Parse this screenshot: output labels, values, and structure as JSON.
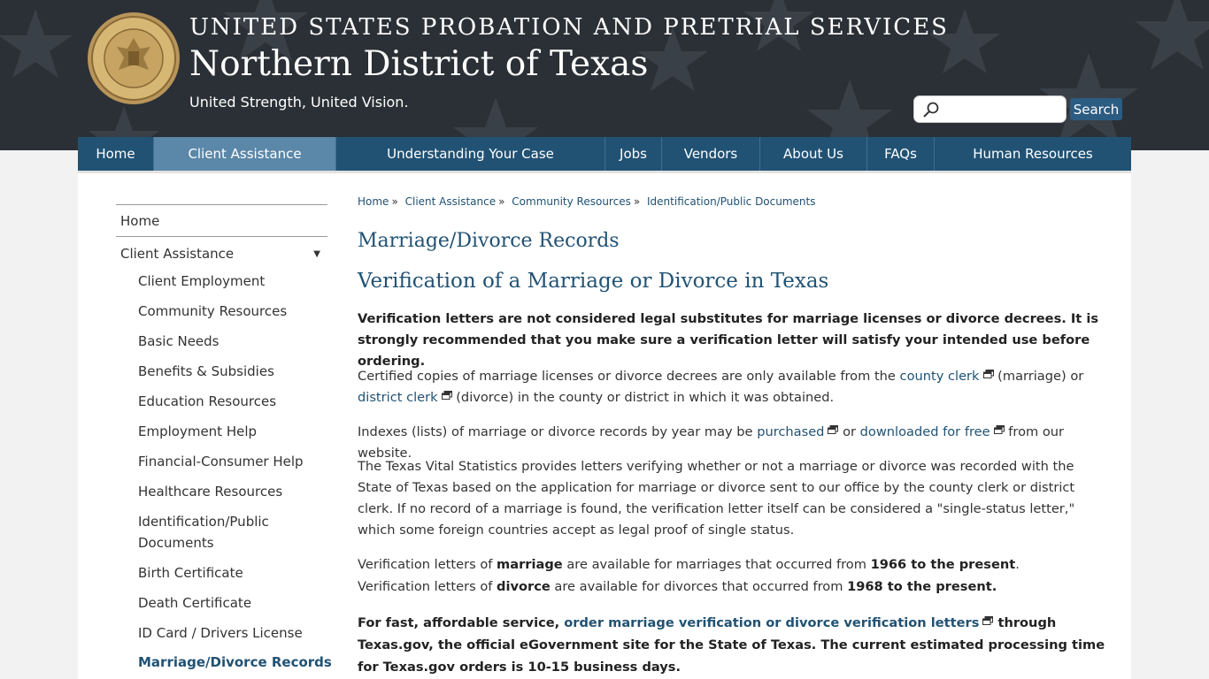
{
  "header": {
    "agency": "UNITED STATES PROBATION AND PRETRIAL SERVICES",
    "district": "Northern District of Texas",
    "tagline": "United Strength, United Vision.",
    "search_placeholder": "",
    "search_label": "Search",
    "seal_text": "U.S. PROBATION & PRETRIAL SERVICES TEXAS NORTHERN"
  },
  "nav": {
    "items": [
      {
        "label": "Home"
      },
      {
        "label": "Client Assistance"
      },
      {
        "label": "Understanding Your Case"
      },
      {
        "label": "Jobs"
      },
      {
        "label": "Vendors"
      },
      {
        "label": "About Us"
      },
      {
        "label": "FAQs"
      },
      {
        "label": "Human Resources"
      }
    ]
  },
  "sidebar": {
    "home": "Home",
    "client_assistance": "Client Assistance",
    "items": [
      "Client Employment",
      "Community Resources",
      "Basic Needs",
      "Benefits & Subsidies",
      "Education Resources",
      "Employment Help",
      "Financial-Consumer Help",
      "Healthcare Resources",
      "Identification/Public",
      "Documents",
      "Birth Certificate",
      "Death Certificate",
      "ID Card / Drivers License",
      "Marriage/Divorce Records"
    ]
  },
  "breadcrumb": {
    "items": [
      "Home",
      "Client Assistance",
      "Community Resources",
      "Identification/Public Documents"
    ],
    "separator": "»"
  },
  "main": {
    "title": "Marriage/Divorce Records",
    "subtitle": "Verification of a Marriage or Divorce in Texas",
    "p1": "Verification letters are not considered legal substitutes for marriage licenses or divorce decrees. It is strongly recommended that you make sure a verification letter will satisfy your intended use before ordering.",
    "p2_a": "Certified copies of marriage licenses or divorce decrees are only available from the ",
    "p2_link1": "county clerk",
    "p2_b": " (marriage) or ",
    "p2_link2": "district clerk",
    "p2_c": " (divorce) in the county or district in which it was obtained.",
    "p3_a": "Indexes (lists) of marriage or divorce records by year may be ",
    "p3_link1": "purchased",
    "p3_b": " or ",
    "p3_link2": "downloaded for free",
    "p3_c": " from our website.",
    "p4": "The Texas Vital Statistics provides letters verifying whether or not a marriage or divorce was recorded with the State of Texas based on the application for marriage or divorce sent to our office by the county clerk or district clerk. If no record of a marriage is found, the verification letter itself can be considered a \"single-status letter,\" which some foreign countries accept as legal proof of single status.",
    "p5_a": "Verification letters of ",
    "p5_b": "marriage",
    "p5_c": " are available for marriages that occurred from ",
    "p5_d": "1966 to the present",
    "p5_e": ".",
    "p6_a": "Verification letters of ",
    "p6_b": "divorce",
    "p6_c": " are available for divorces that occurred from ",
    "p6_d": "1968 to the present.",
    "p7_a": "For fast, affordable service, ",
    "p7_link": "order marriage verification or divorce verification letters",
    "p7_b": " through Texas.gov, the official eGovernment site for the State of Texas. The current estimated processing time for Texas.gov orders is 10-15 business days."
  },
  "colors": {
    "header_bg": "#2b3036",
    "nav_bg": "#215274",
    "nav_active": "#5b87a8",
    "link": "#215274"
  }
}
